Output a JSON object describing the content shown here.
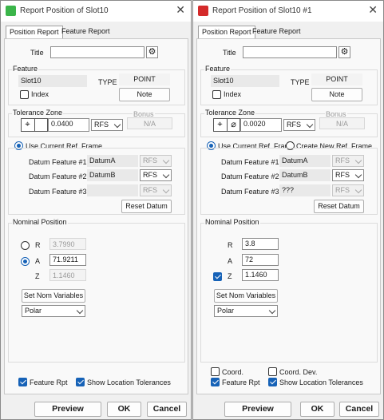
{
  "left": {
    "title": "Report Position of Slot10",
    "tabs": [
      "Position Report",
      "Feature Report"
    ],
    "title_label": "Title",
    "title_value": "",
    "feature_group": "Feature",
    "feature_name": "Slot10",
    "type_label": "TYPE",
    "type_value": "POINT",
    "index_label": "Index",
    "note_button": "Note",
    "tolerance_group": "Tolerance Zone",
    "bonus_label": "Bonus",
    "tolerance_value": "0.0400",
    "material_value": "RFS",
    "bonus_value": "N/A",
    "use_current_frame": "Use Current Ref. Frame",
    "datums": [
      {
        "label": "Datum Feature #1",
        "value": "DatumA",
        "mod": "RFS"
      },
      {
        "label": "Datum Feature #2",
        "value": "DatumB",
        "mod": "RFS"
      },
      {
        "label": "Datum Feature #3",
        "value": "",
        "mod": "RFS"
      }
    ],
    "reset_datum": "Reset Datum",
    "nominal_group": "Nominal Position",
    "r_label": "R",
    "r_value": "3.7990",
    "a_label": "A",
    "a_value": "71.9211",
    "z_label": "Z",
    "z_value": "1.1460",
    "set_nom": "Set Nom Variables",
    "coord_type": "Polar",
    "feature_rpt": "Feature Rpt",
    "show_loc_tol": "Show Location Tolerances",
    "preview": "Preview",
    "ok": "OK",
    "cancel": "Cancel"
  },
  "right": {
    "title": "Report Position of Slot10 #1",
    "tabs": [
      "Position Report",
      "Feature Report"
    ],
    "title_label": "Title",
    "title_value": "",
    "feature_group": "Feature",
    "feature_name": "Slot10",
    "type_label": "TYPE",
    "type_value": "POINT",
    "index_label": "Index",
    "note_button": "Note",
    "tolerance_group": "Tolerance Zone",
    "bonus_label": "Bonus",
    "tolerance_value": "0.0020",
    "material_value": "RFS",
    "bonus_value": "N/A",
    "use_current_frame": "Use Current Ref. Frame",
    "create_new_frame": "Create New Ref. Frame",
    "datums": [
      {
        "label": "Datum Feature #1",
        "value": "DatumA",
        "mod": "RFS"
      },
      {
        "label": "Datum Feature #2",
        "value": "DatumB",
        "mod": "RFS"
      },
      {
        "label": "Datum Feature #3",
        "value": "???",
        "mod": "RFS"
      }
    ],
    "reset_datum": "Reset Datum",
    "nominal_group": "Nominal Position",
    "r_label": "R",
    "r_value": "3.8",
    "a_label": "A",
    "a_value": "72",
    "z_label": "Z",
    "z_value": "1.1460",
    "set_nom": "Set Nom Variables",
    "coord_type": "Polar",
    "coord": "Coord.",
    "coord_dev": "Coord. Dev.",
    "feature_rpt": "Feature Rpt",
    "show_loc_tol": "Show Location Tolerances",
    "preview": "Preview",
    "ok": "OK",
    "cancel": "Cancel"
  },
  "colors": {
    "checked_blue": "#1662b7",
    "left_app_icon": "#3bb54a",
    "right_app_icon": "#d42a2a"
  },
  "icons": [
    "app-icon",
    "close-icon",
    "gear-icon",
    "position-symbol-icon",
    "diameter-symbol-icon",
    "chevron-down-icon"
  ]
}
